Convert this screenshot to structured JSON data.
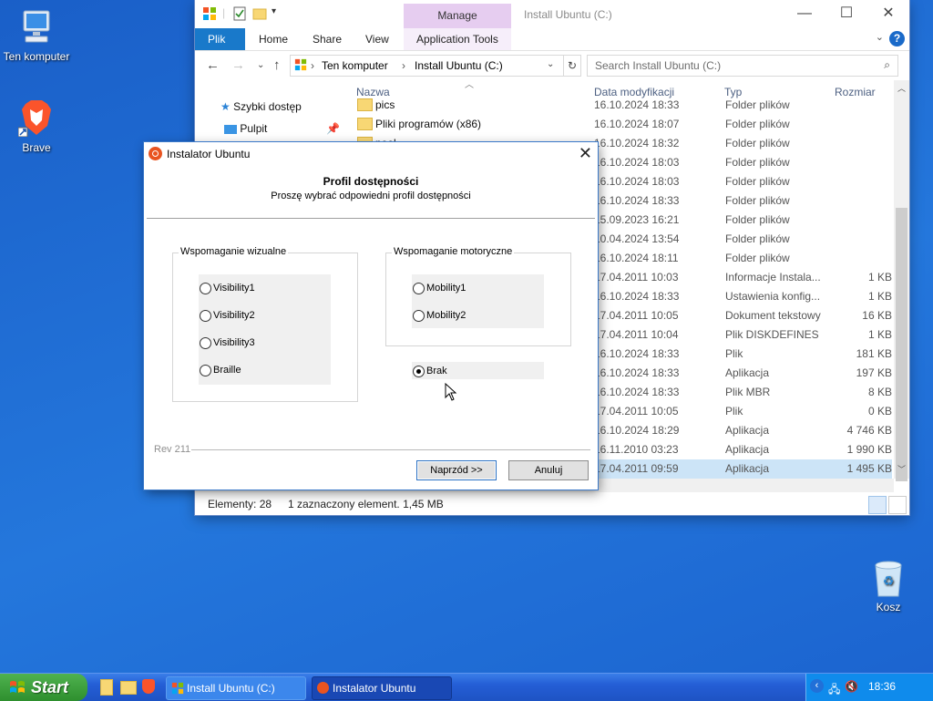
{
  "desktop": {
    "icons": [
      {
        "label": "Ten komputer"
      },
      {
        "label": "Brave"
      }
    ],
    "recycle_bin": {
      "label": "Kosz"
    }
  },
  "explorer": {
    "title": "Install Ubuntu (C:)",
    "manage_tab": "Manage",
    "ribbon_tabs": [
      "Plik",
      "Home",
      "Share",
      "View",
      "Application Tools"
    ],
    "address": {
      "segments": [
        "Ten komputer",
        "Install Ubuntu (C:)"
      ]
    },
    "search": {
      "placeholder": "Search Install Ubuntu (C:)"
    },
    "nav_pane": [
      {
        "label": "Szybki dostęp"
      },
      {
        "label": "Pulpit"
      }
    ],
    "columns": {
      "name": "Nazwa",
      "date": "Data modyfikacji",
      "type": "Typ",
      "size": "Rozmiar"
    },
    "rows": [
      {
        "name": "pics",
        "date": "16.10.2024 18:33",
        "type": "Folder plików",
        "size": ""
      },
      {
        "name": "Pliki programów (x86)",
        "date": "16.10.2024 18:07",
        "type": "Folder plików",
        "size": ""
      },
      {
        "name": "pool",
        "date": "16.10.2024 18:32",
        "type": "Folder plików",
        "size": ""
      },
      {
        "name": "",
        "date": "16.10.2024 18:03",
        "type": "Folder plików",
        "size": ""
      },
      {
        "name": "",
        "date": "16.10.2024 18:03",
        "type": "Folder plików",
        "size": ""
      },
      {
        "name": "",
        "date": "16.10.2024 18:33",
        "type": "Folder plików",
        "size": ""
      },
      {
        "name": "",
        "date": "15.09.2023 16:21",
        "type": "Folder plików",
        "size": ""
      },
      {
        "name": "",
        "date": "10.04.2024 13:54",
        "type": "Folder plików",
        "size": ""
      },
      {
        "name": "",
        "date": "16.10.2024 18:11",
        "type": "Folder plików",
        "size": ""
      },
      {
        "name": "",
        "date": "17.04.2011 10:03",
        "type": "Informacje Instala...",
        "size": "1 KB"
      },
      {
        "name": "",
        "date": "16.10.2024 18:33",
        "type": "Ustawienia konfig...",
        "size": "1 KB"
      },
      {
        "name": "",
        "date": "17.04.2011 10:05",
        "type": "Dokument tekstowy",
        "size": "16 KB"
      },
      {
        "name": "",
        "date": "17.04.2011 10:04",
        "type": "Plik DISKDEFINES",
        "size": "1 KB"
      },
      {
        "name": "",
        "date": "16.10.2024 18:33",
        "type": "Plik",
        "size": "181 KB"
      },
      {
        "name": "",
        "date": "16.10.2024 18:33",
        "type": "Aplikacja",
        "size": "197 KB"
      },
      {
        "name": "",
        "date": "16.10.2024 18:33",
        "type": "Plik MBR",
        "size": "8 KB"
      },
      {
        "name": "",
        "date": "17.04.2011 10:05",
        "type": "Plik",
        "size": "0 KB"
      },
      {
        "name": "",
        "date": "16.10.2024 18:29",
        "type": "Aplikacja",
        "size": "4 746 KB"
      },
      {
        "name": "",
        "date": "16.11.2010 03:23",
        "type": "Aplikacja",
        "size": "1 990 KB"
      },
      {
        "name": "",
        "date": "17.04.2011 09:59",
        "type": "Aplikacja",
        "size": "1 495 KB",
        "selected": true
      }
    ],
    "status": {
      "count": "Elementy: 28",
      "selection": "1 zaznaczony element. 1,45 MB"
    }
  },
  "dialog": {
    "title": "Instalator Ubuntu",
    "heading": "Profil dostępności",
    "subheading": "Proszę wybrać odpowiedni profil dostępności",
    "visual_group": {
      "label": "Wspomaganie wizualne",
      "options": [
        "Visibility1",
        "Visibility2",
        "Visibility3",
        "Braille"
      ]
    },
    "motor_group": {
      "label": "Wspomaganie motoryczne",
      "options": [
        "Mobility1",
        "Mobility2"
      ]
    },
    "none_option": {
      "label": "Brak",
      "selected": true
    },
    "revision": "Rev 211",
    "next_button": "Naprzód >>",
    "cancel_button": "Anuluj"
  },
  "taskbar": {
    "start_label": "Start",
    "tasks": [
      {
        "label": "Install Ubuntu (C:)"
      },
      {
        "label": "Instalator Ubuntu"
      }
    ],
    "clock": "18:36"
  }
}
